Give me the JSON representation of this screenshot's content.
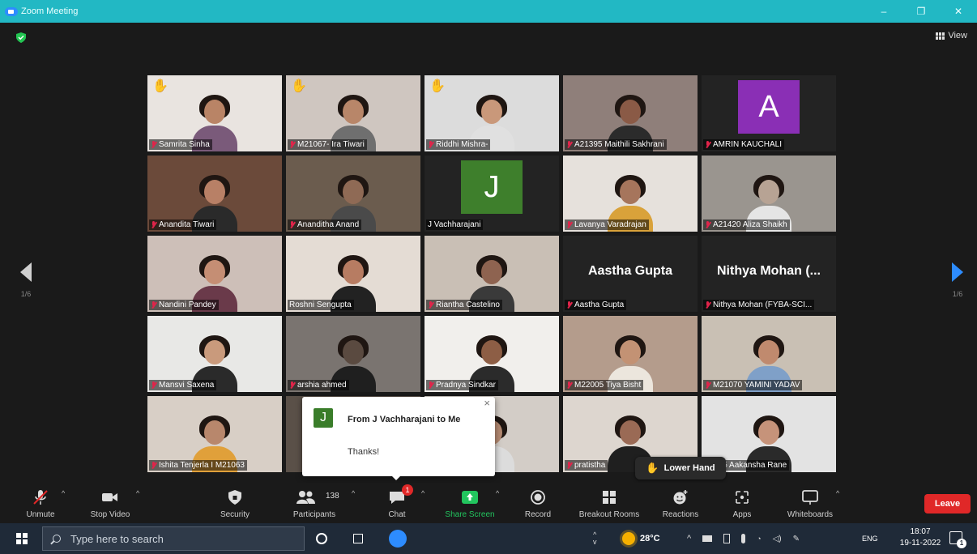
{
  "window": {
    "title": "Zoom Meeting",
    "minimize": "–",
    "maximize": "❐",
    "close": "✕"
  },
  "view_label": "View",
  "pagination": {
    "left": "1/6",
    "right": "1/6"
  },
  "participants": [
    {
      "name": "Samrita Sinha",
      "muted": true,
      "hand": true,
      "bg": "#e9e4e0",
      "skin": "#b98466",
      "shirt": "#7a5a7a"
    },
    {
      "name": "M21067- Ira Tiwari",
      "muted": true,
      "hand": true,
      "bg": "#cfc6c0",
      "skin": "#b88669",
      "shirt": "#6f6f6f"
    },
    {
      "name": "Riddhi Mishra-",
      "muted": true,
      "hand": true,
      "bg": "#dcdcdc",
      "skin": "#c9987a",
      "shirt": "#e0e0e0"
    },
    {
      "name": "A21395 Maithili Sakhrani",
      "muted": true,
      "hand": false,
      "speaking": true,
      "bg": "#8f7f7a",
      "skin": "#8a5a46",
      "shirt": "#2b2b2b"
    },
    {
      "name": "AMRIN KAUCHALI",
      "muted": true,
      "avatar": "A",
      "avatar_color": "#8a2fb5"
    },
    {
      "name": "Anandita Tiwari",
      "muted": true,
      "bg": "#6b4a3a",
      "skin": "#b88066",
      "shirt": "#2a2a2a"
    },
    {
      "name": "Ananditha Anand",
      "muted": true,
      "bg": "#6b5c4e",
      "skin": "#8f6a55",
      "shirt": "#4a4a4a"
    },
    {
      "name": "J Vachharajani",
      "muted": false,
      "avatar": "J",
      "avatar_color": "#3e7f2c"
    },
    {
      "name": "Lavanya Varadrajan",
      "muted": true,
      "bg": "#e6e1dc",
      "skin": "#a6755c",
      "shirt": "#d9a23a"
    },
    {
      "name": "A21420 Aliza Shaikh",
      "muted": true,
      "bg": "#9a958f",
      "skin": "#b7a394",
      "shirt": "#e5e5e5"
    },
    {
      "name": "Nandini Pandey",
      "muted": true,
      "bg": "#cdbfb8",
      "skin": "#c58e74",
      "shirt": "#6a3a4a"
    },
    {
      "name": "Roshni Sengupta",
      "muted": false,
      "bg": "#e4dcd4",
      "skin": "#b77c62",
      "shirt": "#222222"
    },
    {
      "name": "Riantha Castelino",
      "muted": true,
      "bg": "#c9bfb5",
      "skin": "#8e6350",
      "shirt": "#3a3a3a"
    },
    {
      "name": "Aastha Gupta",
      "muted": true,
      "big_name": "Aastha Gupta"
    },
    {
      "name": "Nithya Mohan (FYBA-SCI...",
      "muted": true,
      "big_name": "Nithya Mohan (..."
    },
    {
      "name": "Mansvi Saxena",
      "muted": true,
      "bg": "#e8e8e6",
      "skin": "#c99a7c",
      "shirt": "#2a2a2a"
    },
    {
      "name": "arshia ahmed",
      "muted": true,
      "bg": "#7a7470",
      "skin": "#5a4a40",
      "shirt": "#1f1f1f"
    },
    {
      "name": "Pradnya Sindkar",
      "muted": true,
      "bg": "#f1efec",
      "skin": "#8d5e45",
      "shirt": "#2b2b2b"
    },
    {
      "name": "M22005 Tiya Bisht",
      "muted": true,
      "bg": "#b49c8c",
      "skin": "#c39274",
      "shirt": "#ece6dd"
    },
    {
      "name": "M21070 YAMINI YADAV",
      "muted": true,
      "bg": "#c9c0b4",
      "skin": "#c08a6e",
      "shirt": "#7fa0c8"
    },
    {
      "name": "Ishita Tenjerla I M21063",
      "muted": true,
      "bg": "#d8cfc6",
      "skin": "#b8876c",
      "shirt": "#e0a03a"
    },
    {
      "name": "",
      "muted": true,
      "bg": "#5a5048",
      "skin": "#9b7760",
      "shirt": "#2a2a2a"
    },
    {
      "name": "",
      "muted": false,
      "bg": "#d3cdc7",
      "skin": "#b48a72",
      "shirt": "#dcdcdc"
    },
    {
      "name": "pratistha",
      "muted": true,
      "bg": "#ddd6cf",
      "skin": "#9a6a55",
      "shirt": "#1f1f1f"
    },
    {
      "name": "22035 Aakansha Rane",
      "muted": false,
      "bg": "#e3e3e3",
      "skin": "#c6937a",
      "shirt": "#2a2a2a"
    }
  ],
  "chat_toast": {
    "avatar": "J",
    "from": "From J Vachharajani to Me",
    "message": "Thanks!",
    "close": "×"
  },
  "lower_hand": {
    "label": "Lower Hand"
  },
  "toolbar": {
    "unmute": "Unmute",
    "stop_video": "Stop Video",
    "security": "Security",
    "participants_count": "138",
    "participants": "Participants",
    "chat_badge": "1",
    "chat": "Chat",
    "share_screen": "Share Screen",
    "record": "Record",
    "breakout_rooms": "Breakout Rooms",
    "reactions": "Reactions",
    "apps": "Apps",
    "whiteboards": "Whiteboards",
    "leave": "Leave"
  },
  "taskbar": {
    "search_placeholder": "Type here to search",
    "temperature": "28°C",
    "language": "ENG",
    "time": "18:07",
    "date": "19-11-2022",
    "notifications": "1"
  },
  "colors": {
    "accent": "#2d8cff",
    "leave": "#e02828",
    "share": "#22c55e",
    "titlebar": "#22b8c4",
    "speaking": "#c6e53d"
  }
}
